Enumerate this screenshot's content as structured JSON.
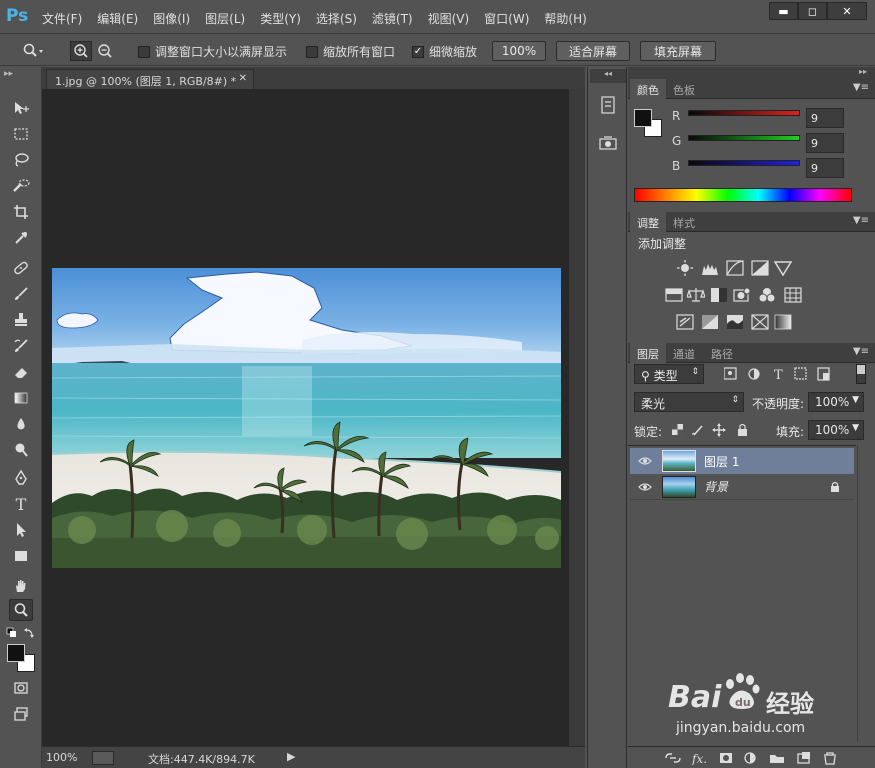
{
  "app": {
    "logo": "Ps",
    "menus": [
      "文件(F)",
      "编辑(E)",
      "图像(I)",
      "图层(L)",
      "类型(Y)",
      "选择(S)",
      "滤镜(T)",
      "视图(V)",
      "窗口(W)",
      "帮助(H)"
    ]
  },
  "options": {
    "resize_windows": "调整窗口大小以满屏显示",
    "zoom_all": "缩放所有窗口",
    "scrubby_zoom": "细微缩放",
    "btn_100": "100%",
    "btn_fit": "适合屏幕",
    "btn_fill": "填充屏幕"
  },
  "document": {
    "tab_title": "1.jpg @ 100% (图层 1, RGB/8#) *",
    "zoom": "100%",
    "doc_size": "文档:447.4K/894.7K"
  },
  "color_panel": {
    "tabs": [
      "颜色",
      "色板"
    ],
    "channels": [
      {
        "label": "R",
        "value": "9",
        "color": "#e02020"
      },
      {
        "label": "G",
        "value": "9",
        "color": "#20d020"
      },
      {
        "label": "B",
        "value": "9",
        "color": "#2020e0"
      }
    ]
  },
  "adjust_panel": {
    "tabs": [
      "调整",
      "样式"
    ],
    "title": "添加调整"
  },
  "layers_panel": {
    "tabs": [
      "图层",
      "通道",
      "路径"
    ],
    "filter_kind": "类型",
    "blend_mode": "柔光",
    "opacity_label": "不透明度:",
    "opacity_value": "100%",
    "lock_label": "锁定:",
    "fill_label": "填充:",
    "fill_value": "100%",
    "layers": [
      {
        "name": "图层 1",
        "selected": true
      },
      {
        "name": "背景",
        "selected": false,
        "locked": true
      }
    ]
  },
  "watermark": {
    "brand": "Bai",
    "brand_tail": "经验",
    "url": "jingyan.baidu.com"
  }
}
